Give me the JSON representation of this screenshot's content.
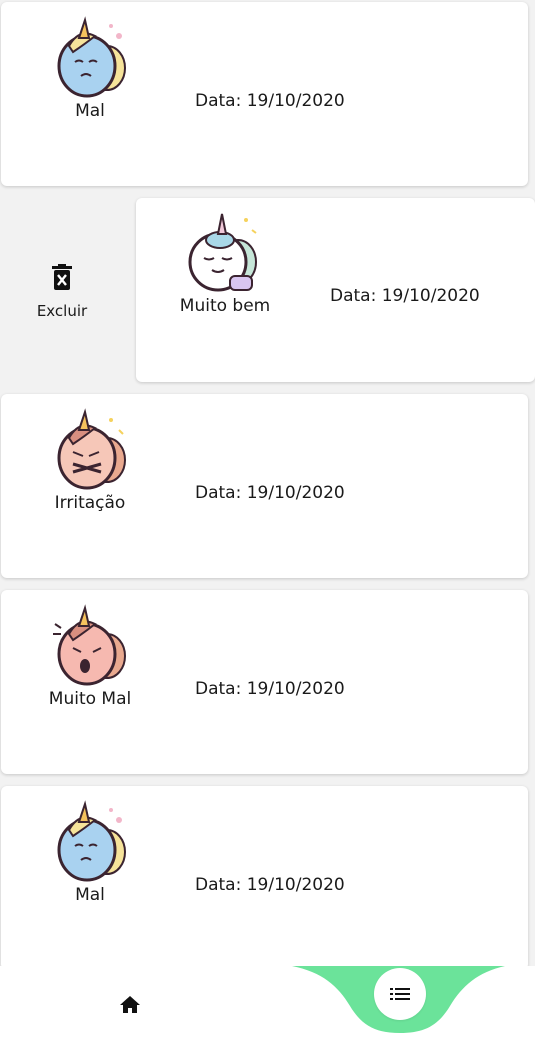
{
  "entries": [
    {
      "mood": "Mal",
      "date": "Data: 19/10/2020",
      "icon": "unicorn-sad-icon"
    },
    {
      "mood": "Muito bem",
      "date": "Data: 19/10/2020",
      "icon": "unicorn-happy-icon"
    },
    {
      "mood": "Irritação",
      "date": "Data: 19/10/2020",
      "icon": "unicorn-irritated-icon"
    },
    {
      "mood": "Muito Mal",
      "date": "Data: 19/10/2020",
      "icon": "unicorn-crying-icon"
    },
    {
      "mood": "Mal",
      "date": "Data: 19/10/2020",
      "icon": "unicorn-sad-icon"
    }
  ],
  "swipe_action": {
    "label": "Excluir",
    "icon": "trash-icon"
  },
  "nav": {
    "home_icon": "home-icon",
    "list_icon": "list-icon",
    "active": "list",
    "accent_color": "#6be39a"
  }
}
